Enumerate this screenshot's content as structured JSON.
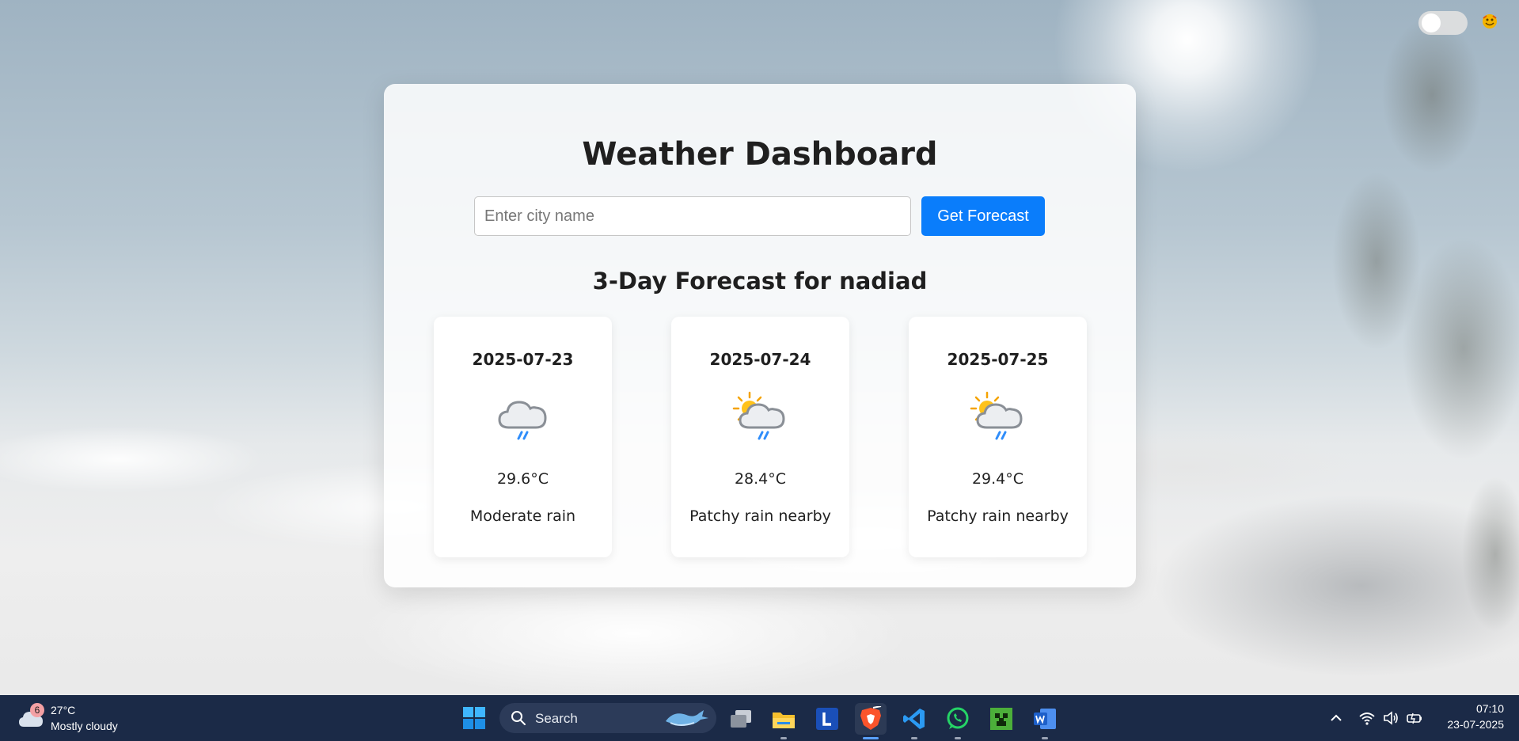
{
  "app": {
    "title": "Weather Dashboard",
    "search_placeholder": "Enter city name",
    "search_value": "",
    "button_label": "Get Forecast",
    "forecast_heading": "3-Day Forecast for nadiad",
    "accent_color": "#0a7dfb",
    "theme_toggle_on": false
  },
  "forecast": [
    {
      "date": "2025-07-23",
      "icon": "rain-cloud-icon",
      "temp": "29.6°C",
      "condition": "Moderate rain"
    },
    {
      "date": "2025-07-24",
      "icon": "sun-cloud-rain-icon",
      "temp": "28.4°C",
      "condition": "Patchy rain nearby"
    },
    {
      "date": "2025-07-25",
      "icon": "sun-cloud-rain-icon",
      "temp": "29.4°C",
      "condition": "Patchy rain nearby"
    }
  ],
  "taskbar": {
    "weather_badge": "6",
    "weather_temp": "27°C",
    "weather_condition": "Mostly cloudy",
    "search_label": "Search",
    "apps": [
      "task-view-icon",
      "file-explorer-icon",
      "l-app-icon",
      "brave-browser-icon",
      "vscode-icon",
      "whatsapp-icon",
      "minecraft-icon",
      "word-icon"
    ],
    "time": "07:10",
    "date": "23-07-2025"
  }
}
